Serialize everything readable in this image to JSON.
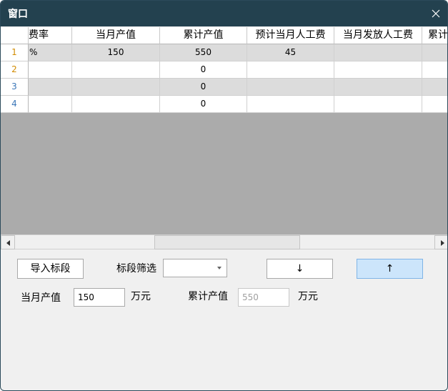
{
  "window": {
    "title": "窗口"
  },
  "grid": {
    "columns": [
      "费率",
      "当月产值",
      "累计产值",
      "预计当月人工费",
      "当月发放人工费",
      "累计"
    ],
    "rows": [
      {
        "num": "1",
        "cells": [
          "%",
          "150",
          "550",
          "45",
          "",
          ""
        ]
      },
      {
        "num": "2",
        "cells": [
          "",
          "",
          "0",
          "",
          "",
          ""
        ]
      },
      {
        "num": "3",
        "cells": [
          "",
          "",
          "0",
          "",
          "",
          ""
        ]
      },
      {
        "num": "4",
        "cells": [
          "",
          "",
          "0",
          "",
          "",
          ""
        ]
      }
    ]
  },
  "controls": {
    "import_button": "导入标段",
    "filter_label": "标段筛选",
    "filter_value": "",
    "down_button": "↓",
    "up_button": "↑",
    "monthly_label": "当月产值",
    "monthly_value": "150",
    "monthly_unit": "万元",
    "cumulative_label": "累计产值",
    "cumulative_value": "550",
    "cumulative_unit": "万元"
  },
  "colors": {
    "titlebar": "#23414f",
    "grid_background": "#ababab",
    "row_gray": "#dcdcdc",
    "rownum_odd": "#d18b00",
    "rownum_even": "#3a76b8",
    "primary_button": "#cce5fb"
  },
  "icons": {
    "close": "close-icon",
    "scroll_left": "scroll-left-arrow-icon",
    "scroll_right": "scroll-right-arrow-icon",
    "combo_dropdown": "chevron-down-icon"
  }
}
